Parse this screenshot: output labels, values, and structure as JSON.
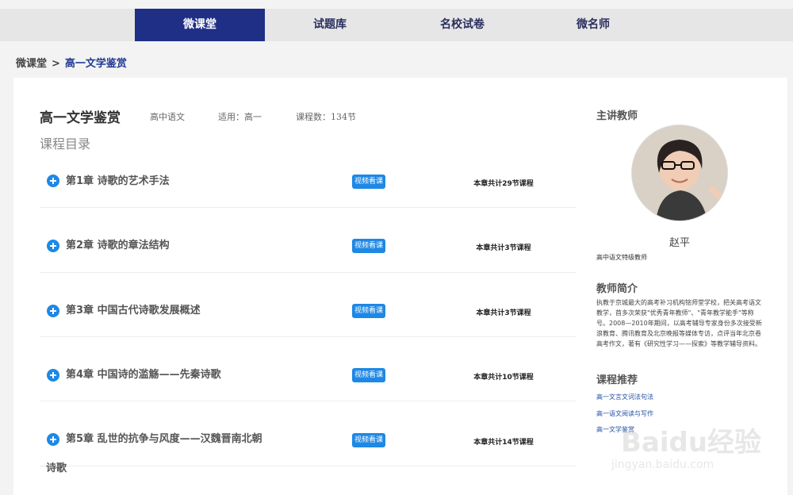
{
  "nav": {
    "tabs": [
      {
        "label": "微课堂",
        "active": true
      },
      {
        "label": "试题库",
        "active": false
      },
      {
        "label": "名校试卷",
        "active": false
      },
      {
        "label": "微名师",
        "active": false
      }
    ]
  },
  "breadcrumb": {
    "home": "微课堂",
    "separator": ">",
    "current": "高一文学鉴赏"
  },
  "course": {
    "title": "高一文学鉴赏",
    "subject": "高中语文",
    "grade": "适用：高一",
    "lesson_count": "课程数：134节",
    "catalog_title": "课程目录"
  },
  "chapters": [
    {
      "name": "第1章  诗歌的艺术手法",
      "button": "视频看课",
      "count": "本章共计29节课程"
    },
    {
      "name": "第2章  诗歌的章法结构",
      "button": "视频看课",
      "count": "本章共计3节课程"
    },
    {
      "name": "第3章  中国古代诗歌发展概述",
      "button": "视频看课",
      "count": "本章共计3节课程"
    },
    {
      "name": "第4章  中国诗的滥觞——先秦诗歌",
      "button": "视频看课",
      "count": "本章共计10节课程"
    },
    {
      "name": "第5章  乱世的抗争与风度——汉魏晋南北朝",
      "name_wrap": "诗歌",
      "button": "视频看课",
      "count": "本章共计14节课程"
    }
  ],
  "sidebar": {
    "teacher_heading": "主讲教师",
    "teacher_name": "赵平",
    "teacher_role": "高中语文特级教师",
    "intro_heading": "教师简介",
    "intro_text": "执教于京城最大的高考补习机构铭师堂学校，把关高考语文教学，首多次荣获\"优秀青年教师\"、\"青年教学能手\"等称号。2008—2010年期间，以高考辅导专家身份多次接受新浪教育、腾讯教育及北京晚报等媒体专访，点评当年北京卷高考作文，著有《研究性学习——探索》等教学辅导资料。",
    "rec_heading": "课程推荐",
    "recommendations": [
      "高一文言文词法句法",
      "高一语文阅读与写作",
      "高一文学鉴赏"
    ]
  },
  "watermark": {
    "brand": "Baidu经验",
    "url": "jingyan.baidu.com"
  },
  "colors": {
    "nav_active": "#1f2f86",
    "button_blue": "#1e88e5",
    "link_blue": "#1f4fa3"
  }
}
